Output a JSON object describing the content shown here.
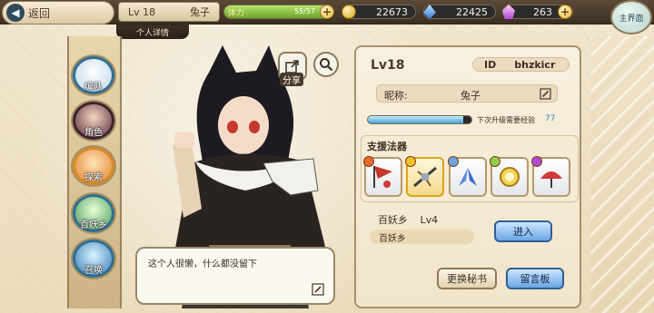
{
  "header": {
    "back_label": "返回",
    "level": "Lv 18",
    "name": "兔子",
    "subtitle": "个人详情",
    "stamina_label": "体力",
    "stamina_value": "55/57",
    "stamina_fraction": 0.96,
    "gold": "22673",
    "gems": "22425",
    "crystals": "263",
    "main_label": "主界面"
  },
  "side_menu": [
    {
      "label": "编队"
    },
    {
      "label": "角色"
    },
    {
      "label": "探索"
    },
    {
      "label": "百妖乡"
    },
    {
      "label": "召唤"
    }
  ],
  "actions": {
    "share_label": "分享"
  },
  "speech": {
    "text": "这个人很懒，什么都没留下"
  },
  "profile": {
    "level": "Lv18",
    "id_label": "ID",
    "id_value": "bhzkicr",
    "nickname_label": "昵称:",
    "nickname_value": "兔子",
    "exp_label": "下次升级需要经验",
    "exp_value": "77",
    "exp_fraction": 0.92,
    "support_title": "支援法器",
    "village_name": "百妖乡",
    "village_level": "Lv4",
    "village_bar": "百妖乡",
    "enter_label": "进入",
    "change_secretary_label": "更换秘书",
    "message_board_label": "留言板"
  },
  "colors": {
    "accent_blue": "#6aa6e4",
    "stamina_green": "#6aa32d",
    "exp_blue": "#4aa0d6"
  }
}
